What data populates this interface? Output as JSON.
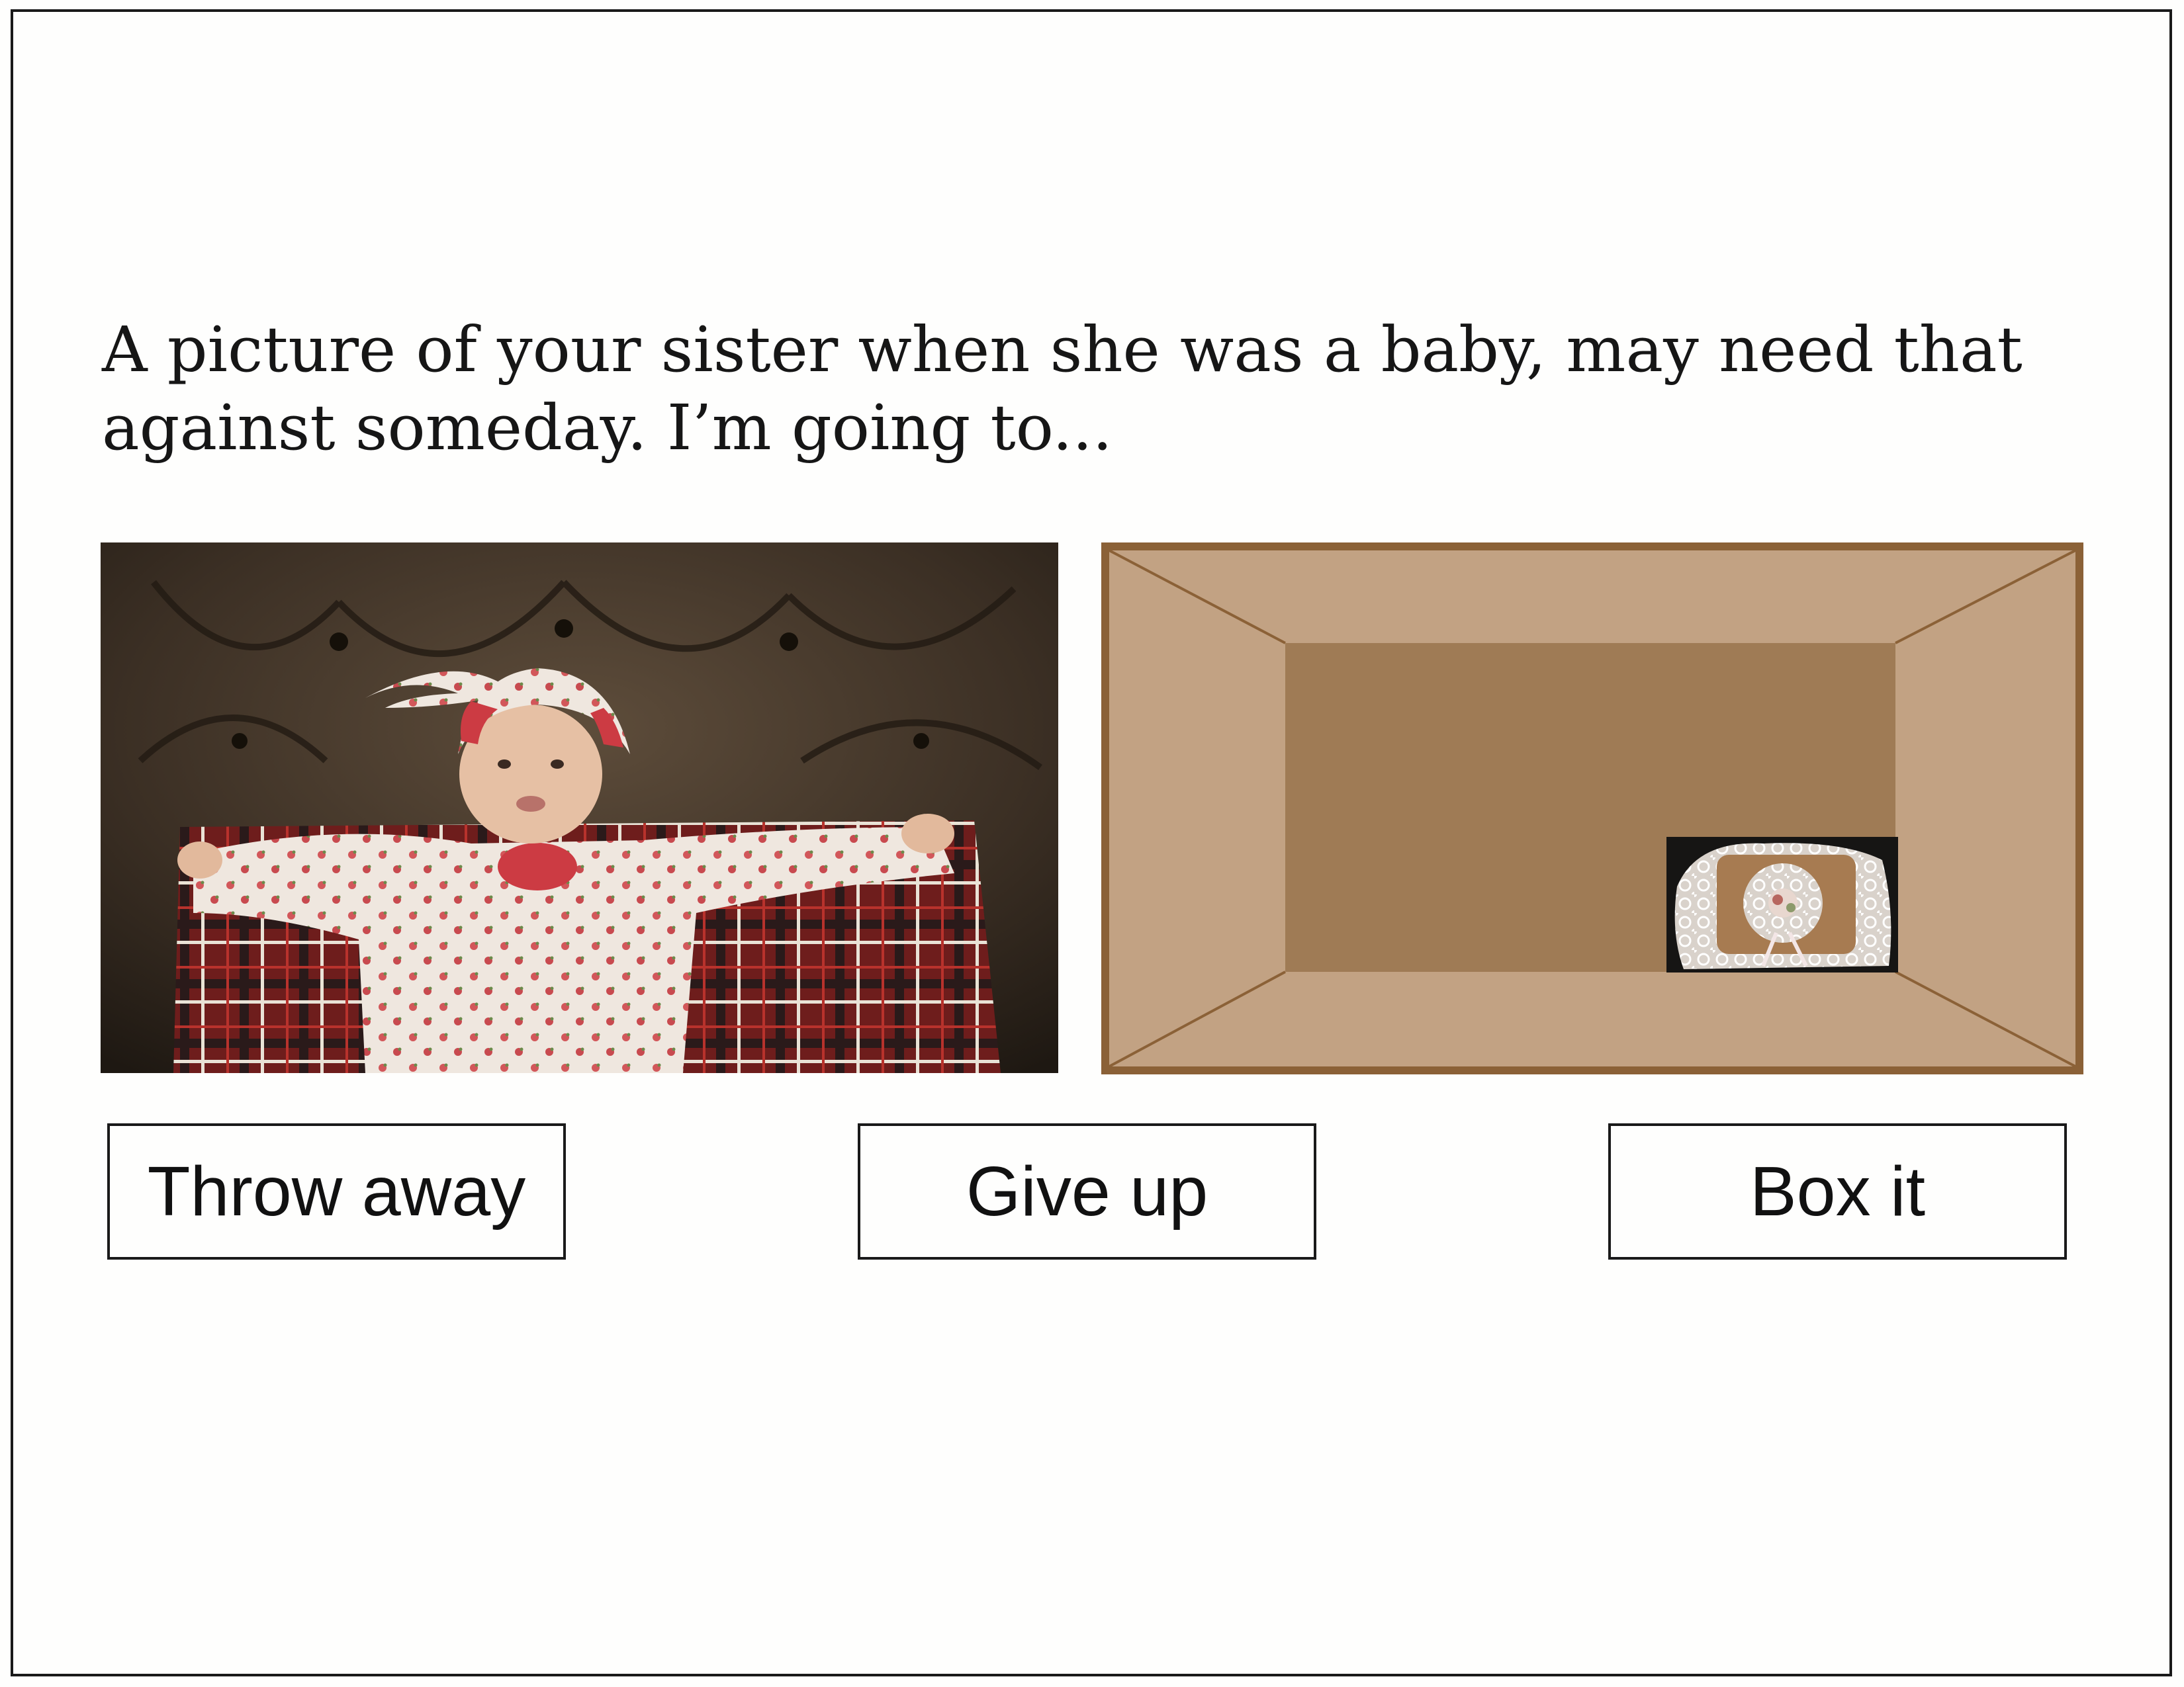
{
  "prompt": {
    "line1": "A picture of your sister when she was a baby, may need that",
    "line2": "against someday.  I’m going to..."
  },
  "images": {
    "item_photo": "baby-photo",
    "box_preview": "open-cardboard-box-with-lace-pillow"
  },
  "choices": {
    "throw_away": "Throw away",
    "give_up": "Give up",
    "box_it": "Box it"
  },
  "colors": {
    "box_edge": "#8b6137",
    "box_flap": "#c2a283",
    "box_floor": "#9f7b55",
    "button_border": "#1a1a1a"
  }
}
